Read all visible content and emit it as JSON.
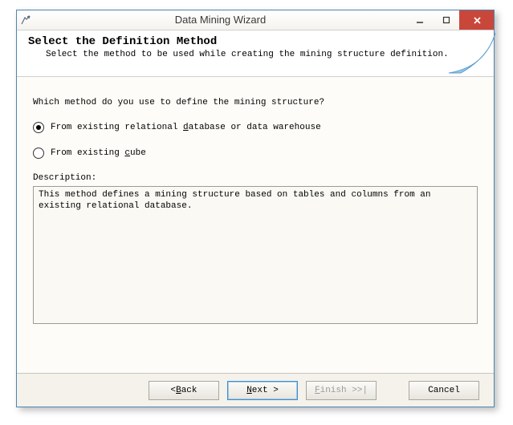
{
  "window": {
    "title": "Data Mining Wizard"
  },
  "banner": {
    "title": "Select the Definition Method",
    "subtitle": "Select the method to be used while creating the mining structure definition."
  },
  "content": {
    "question": "Which method do you use to define the mining structure?",
    "option1_before": "From existing relational ",
    "option1_accel": "d",
    "option1_after": "atabase or data warehouse",
    "option2_before": "From existing ",
    "option2_accel": "c",
    "option2_after": "ube",
    "description_label": "Description:",
    "description_text": "This method defines a mining structure based on tables and columns from an existing relational database."
  },
  "buttons": {
    "back_pre": "< ",
    "back_accel": "B",
    "back_post": "ack",
    "next_accel": "N",
    "next_post": "ext >",
    "finish_accel": "F",
    "finish_post": "inish >>|",
    "cancel": "Cancel"
  }
}
